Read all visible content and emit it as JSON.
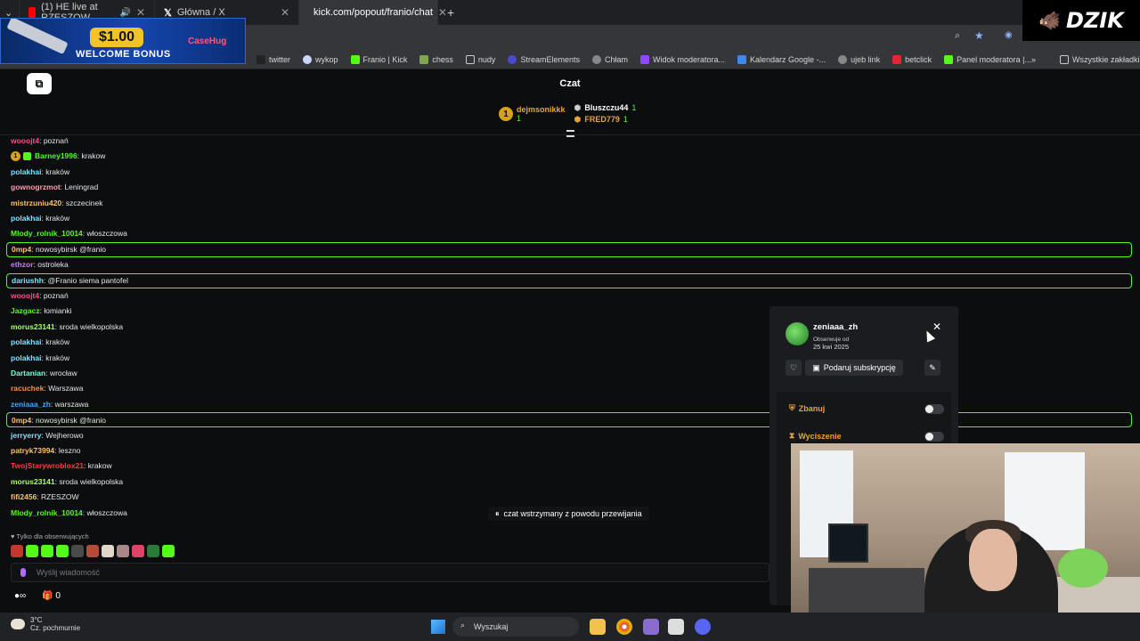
{
  "browser": {
    "tabs": [
      {
        "label": "(1) HE live at RZESZOW",
        "active": false,
        "icon": "youtube-icon"
      },
      {
        "label": "Główna / X",
        "active": false,
        "icon": "x-icon"
      },
      {
        "label": "kick.com/popout/franio/chat",
        "active": true,
        "icon": "kick-icon"
      }
    ],
    "bookmarks": [
      "twitter",
      "wykop",
      "Franio | Kick",
      "chess",
      "nudy",
      "StreamElements",
      "Chłam",
      "Widok moderatora...",
      "Kalendarz Google -...",
      "ujeb link",
      "betclick",
      "Panel moderatora |..."
    ],
    "all_bookmarks": "Wszystkie zakładki"
  },
  "ad": {
    "price": "$1.00",
    "bonus": "WELCOME BONUS",
    "brand": "CaseHug"
  },
  "overlay_logo": "DZIK",
  "chat": {
    "title": "Czat",
    "top_gifters": [
      {
        "name": "dejmsonikkk",
        "count": "1",
        "color": "#e8a33a"
      },
      {
        "name": "Bluszczu44",
        "count": "1",
        "color": "#ffffff"
      },
      {
        "name": "FRED779",
        "count": "1",
        "color": "#e8a33a"
      }
    ],
    "messages": [
      {
        "user": "wooojt4",
        "text": ": poznań",
        "color": "#ff4b8b",
        "hl": false,
        "badge": false
      },
      {
        "user": "Barney1996",
        "text": ": krakow",
        "color": "#53fc18",
        "hl": false,
        "badge": true
      },
      {
        "user": "polakhai",
        "text": ": kraków",
        "color": "#7fe3ff",
        "hl": false,
        "badge": false
      },
      {
        "user": "gownogrzmot",
        "text": ": Leningrad",
        "color": "#ff9fb0",
        "hl": false,
        "badge": false
      },
      {
        "user": "mistrzuniu420",
        "text": ": szczecinek",
        "color": "#ffc266",
        "hl": false,
        "badge": false
      },
      {
        "user": "polakhai",
        "text": ": kraków",
        "color": "#7fe3ff",
        "hl": false,
        "badge": false
      },
      {
        "user": "Mlody_rolnik_10014",
        "text": ": włoszczowa",
        "color": "#53fc18",
        "hl": false,
        "badge": false
      },
      {
        "user": "0mp4",
        "text": ": nowosybirsk @franio",
        "color": "#ffc266",
        "hl": true,
        "badge": false
      },
      {
        "user": "ethzor",
        "text": ": ostroleka",
        "color": "#c77dff",
        "hl": false,
        "badge": false
      },
      {
        "user": "dariushh",
        "text": ": @Franio siema pantofel",
        "color": "#7fe3ff",
        "hl": true,
        "badge": false
      },
      {
        "user": "wooojt4",
        "text": ": poznań",
        "color": "#ff4b8b",
        "hl": false,
        "badge": false
      },
      {
        "user": "Jazgacz",
        "text": ": łomianki",
        "color": "#53fc18",
        "hl": false,
        "badge": false
      },
      {
        "user": "morus23141",
        "text": ": sroda wielkopolska",
        "color": "#a7ff63",
        "hl": false,
        "badge": false
      },
      {
        "user": "polakhai",
        "text": ": kraków",
        "color": "#7fe3ff",
        "hl": false,
        "badge": false
      },
      {
        "user": "polakhai",
        "text": ": kraków",
        "color": "#7fe3ff",
        "hl": false,
        "badge": false
      },
      {
        "user": "Dartanian",
        "text": ": wrocław",
        "color": "#7fffd4",
        "hl": false,
        "badge": false
      },
      {
        "user": "racuchek",
        "text": ": Warszawa",
        "color": "#ff8c42",
        "hl": false,
        "badge": false
      },
      {
        "user": "zeniaaa_zh",
        "text": ": warszawa",
        "color": "#3fa9ff",
        "hl": false,
        "badge": false
      },
      {
        "user": "0mp4",
        "text": ": nowosybirsk @franio",
        "color": "#ffc266",
        "hl": true,
        "badge": false
      },
      {
        "user": "jerryerry",
        "text": ": Wejherowo",
        "color": "#7fe3ff",
        "hl": false,
        "badge": false
      },
      {
        "user": "patryk73994",
        "text": ": leszno",
        "color": "#ffc266",
        "hl": false,
        "badge": false
      },
      {
        "user": "TwojStarywroblox21",
        "text": ": krakow",
        "color": "#ff3b3b",
        "hl": false,
        "badge": false
      },
      {
        "user": "morus23141",
        "text": ": sroda wielkopolska",
        "color": "#a7ff63",
        "hl": false,
        "badge": false
      },
      {
        "user": "fifi2456",
        "text": ": RZESZOW",
        "color": "#ffc266",
        "hl": false,
        "badge": false
      },
      {
        "user": "Mlody_rolnik_10014",
        "text": ": włoszczowa",
        "color": "#53fc18",
        "hl": false,
        "badge": false
      }
    ],
    "pause_note": "czat wstrzymany z powodu przewijania",
    "followers_only": "Tylko dla obserwujących",
    "input_placeholder": "Wyślij wiadomość",
    "bottom_count": "0"
  },
  "user_card": {
    "name": "zeniaaa_zh",
    "follow_label": "Obserwuje od",
    "follow_date": "25 kwi 2025",
    "gift_sub": "Podaruj subskrypcję",
    "ban": "Zbanuj",
    "mute": "Wyciszenie"
  },
  "taskbar": {
    "temp": "3°C",
    "weather": "Cz. pochmurnie",
    "search": "Wyszukaj"
  }
}
